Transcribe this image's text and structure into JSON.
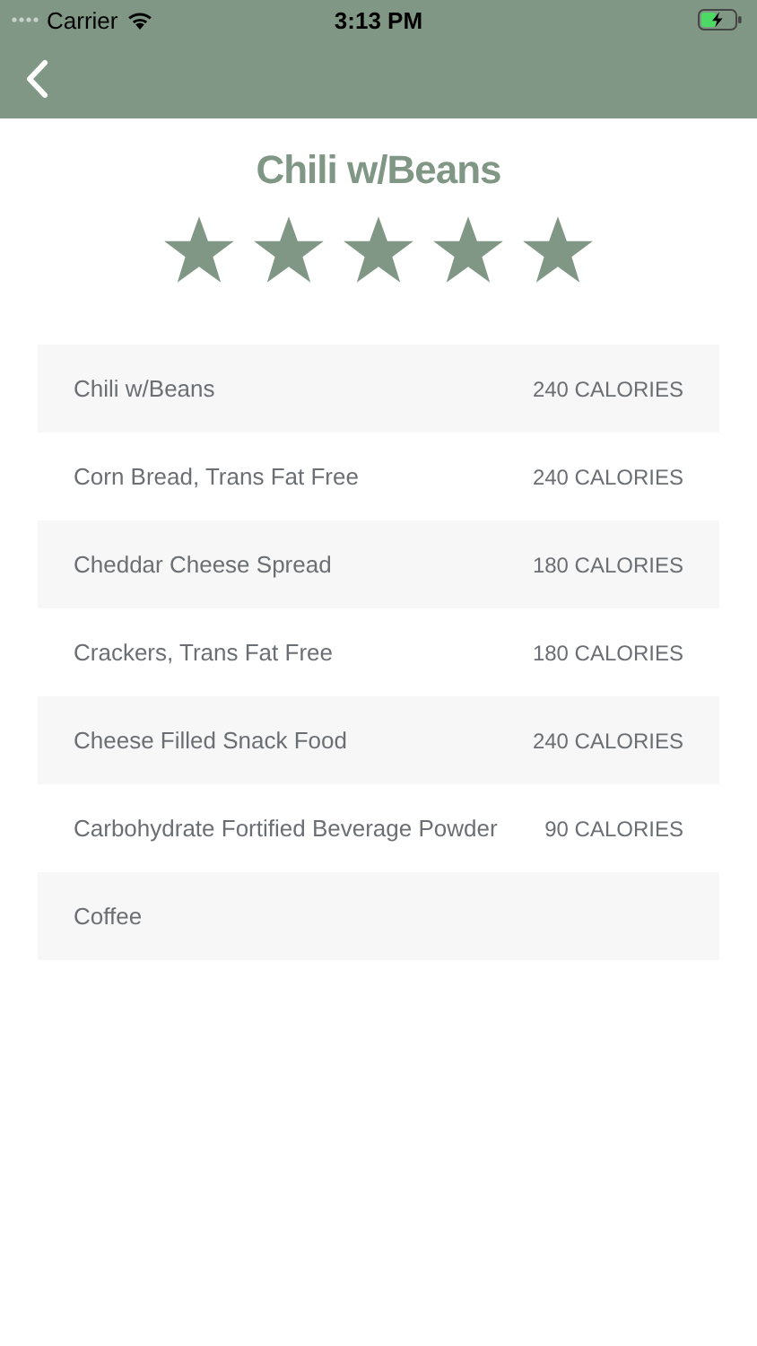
{
  "status_bar": {
    "carrier": "Carrier",
    "time": "3:13 PM"
  },
  "title": "Chili w/Beans",
  "rating": {
    "stars": 5
  },
  "items": [
    {
      "name": "Chili w/Beans",
      "calories": "240 CALORIES"
    },
    {
      "name": "Corn Bread, Trans Fat Free",
      "calories": "240 CALORIES"
    },
    {
      "name": "Cheddar Cheese Spread",
      "calories": "180 CALORIES"
    },
    {
      "name": "Crackers, Trans Fat Free",
      "calories": "180 CALORIES"
    },
    {
      "name": "Cheese Filled Snack Food",
      "calories": "240 CALORIES"
    },
    {
      "name": "Carbohydrate Fortified Beverage Powder",
      "calories": "90 CALORIES"
    },
    {
      "name": "Coffee"
    }
  ]
}
